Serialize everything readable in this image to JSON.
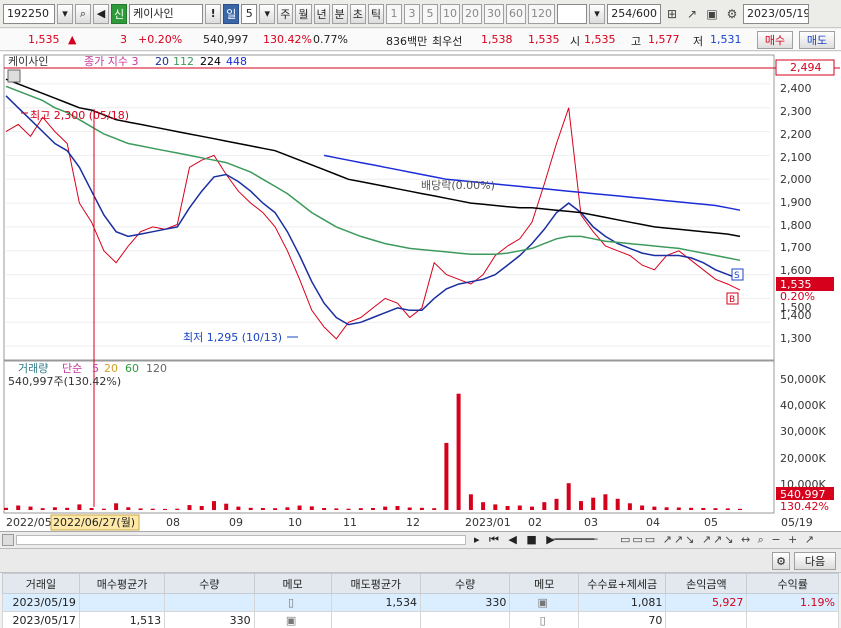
{
  "toolbar": {
    "code": "192250",
    "credit_badge": "신",
    "stock_name": "케이사인",
    "warn": "!",
    "period_active": "일",
    "period_count": "5",
    "periods": [
      "주",
      "월",
      "년",
      "분",
      "초",
      "틱"
    ],
    "intervals": [
      "1",
      "3",
      "5",
      "10",
      "20",
      "30",
      "60",
      "120"
    ],
    "page_counter": "254/600",
    "date": "2023/05/19"
  },
  "quote": {
    "price": "1,535",
    "change_arrow": "▲",
    "change": "3",
    "change_pct": "+0.20%",
    "volume": "540,997",
    "volume_ratio": "130.42%",
    "turnover": "0.77%",
    "amount": "836백만",
    "best_ask_label": "최우선",
    "best_ask": "1,538",
    "best_bid": "1,535",
    "open_label": "시",
    "open": "1,535",
    "high_label": "고",
    "high": "1,577",
    "low_label": "저",
    "low": "1,531",
    "buy_label": "매수",
    "sell_label": "매도"
  },
  "chart": {
    "title": "케이사인",
    "legend_label": "종가 지수 3",
    "legend_ma": [
      "20",
      "112",
      "224",
      "448"
    ],
    "legend_colors": [
      "#1a2ea0",
      "#3d9a5d",
      "#000000",
      "#1b2cd8"
    ],
    "high_annotation": "최고 2,300 (05/18)",
    "low_annotation": "최저 1,295 (10/13)",
    "dividend_annotation": "배당락(0.00%)",
    "top_price_tag": "2,494",
    "price_tag": "1,535",
    "pct_tag": "0.20%",
    "sell_marker": "S",
    "buy_marker": "B",
    "price_axis": [
      "2,400",
      "2,300",
      "2,200",
      "2,100",
      "2,000",
      "1,900",
      "1,800",
      "1,700",
      "1,600",
      "1,500",
      "1,400",
      "1,300"
    ],
    "volume_label": "거래량",
    "volume_ma_label": "단순",
    "volume_ma": [
      "5",
      "20",
      "60",
      "120"
    ],
    "volume_ma_colors": [
      "#c9369b",
      "#d2a020",
      "#2f9a3a",
      "#666666"
    ],
    "volume_value": "540,997주(130.42%)",
    "volume_axis": [
      "50,000K",
      "40,000K",
      "30,000K",
      "20,000K",
      "10,000K"
    ],
    "volume_tag": "540,997",
    "volume_pct_tag": "130.42%",
    "date_axis": [
      "2022/05",
      "08",
      "09",
      "10",
      "11",
      "12",
      "2023/01",
      "02",
      "03",
      "04",
      "05",
      "05/19"
    ],
    "crosshair_date": "2022/06/27(월)"
  },
  "grid_toolbar": {
    "next_label": "다음"
  },
  "trades": {
    "columns": [
      "거래일",
      "매수평균가",
      "수량",
      "메모",
      "매도평균가",
      "수량",
      "메모",
      "수수료+제세금",
      "손익금액",
      "수익률"
    ],
    "rows": [
      {
        "date": "2023/05/19",
        "buy_avg": "",
        "buy_qty": "",
        "sell_avg": "1,534",
        "sell_qty": "330",
        "fee": "1,081",
        "pnl": "5,927",
        "rate": "1.19%"
      },
      {
        "date": "2023/05/17",
        "buy_avg": "1,513",
        "buy_qty": "330",
        "sell_avg": "",
        "sell_qty": "",
        "fee": "70",
        "pnl": "",
        "rate": ""
      }
    ]
  },
  "chart_data": {
    "type": "line",
    "title": "케이사인",
    "x_range": [
      "2022/05",
      "2023/05/19"
    ],
    "ylim": [
      1250,
      2450
    ],
    "price_series": [
      {
        "name": "종가",
        "values": [
          2200,
          2230,
          2180,
          2260,
          2200,
          2150,
          1900,
          1820,
          1700,
          1650,
          1720,
          1780,
          1800,
          1790,
          1810,
          2050,
          2080,
          2100,
          2020,
          1950,
          1900,
          1860,
          1800,
          1700,
          1580,
          1450,
          1380,
          1330,
          1400,
          1420,
          1460,
          1500,
          1480,
          1420,
          1460,
          1650,
          1600,
          1580,
          1560,
          1600,
          1680,
          1720,
          1750,
          1820,
          1980,
          2150,
          2300,
          1850,
          1780,
          1720,
          1700,
          1680,
          1640,
          1620,
          1680,
          1700,
          1660,
          1620,
          1580,
          1560,
          1535
        ]
      },
      {
        "name": "20",
        "values": [
          2350,
          2300,
          2250,
          2200,
          2150,
          2120,
          2050,
          1950,
          1850,
          1780,
          1760,
          1770,
          1780,
          1790,
          1800,
          1880,
          1950,
          2010,
          2020,
          1990,
          1950,
          1900,
          1860,
          1780,
          1680,
          1570,
          1480,
          1420,
          1390,
          1400,
          1420,
          1440,
          1460,
          1450,
          1450,
          1500,
          1540,
          1560,
          1570,
          1580,
          1600,
          1640,
          1680,
          1730,
          1790,
          1860,
          1900,
          1860,
          1800,
          1760,
          1730,
          1710,
          1690,
          1680,
          1680,
          1680,
          1670,
          1650,
          1620,
          1600,
          1580
        ]
      },
      {
        "name": "112",
        "values": [
          2390,
          2370,
          2350,
          2330,
          2300,
          2280,
          2250,
          2220,
          2190,
          2170,
          2150,
          2140,
          2130,
          2120,
          2110,
          2100,
          2090,
          2080,
          2070,
          2050,
          2030,
          2000,
          1970,
          1940,
          1900,
          1860,
          1830,
          1800,
          1780,
          1760,
          1745,
          1730,
          1720,
          1710,
          1705,
          1700,
          1695,
          1690,
          1685,
          1685,
          1685,
          1690,
          1700,
          1710,
          1730,
          1750,
          1760,
          1760,
          1750,
          1740,
          1735,
          1730,
          1725,
          1720,
          1715,
          1710,
          1700,
          1690,
          1680,
          1670,
          1660
        ]
      },
      {
        "name": "224",
        "values": [
          2420,
          2400,
          2380,
          2360,
          2340,
          2320,
          2300,
          2290,
          2270,
          2250,
          2240,
          2230,
          2220,
          2210,
          2200,
          2190,
          2180,
          2170,
          2160,
          2150,
          2140,
          2130,
          2120,
          2100,
          2080,
          2060,
          2040,
          2020,
          2000,
          1990,
          1980,
          1970,
          1960,
          1950,
          1940,
          1930,
          1920,
          1910,
          1900,
          1895,
          1890,
          1885,
          1880,
          1880,
          1875,
          1870,
          1865,
          1860,
          1850,
          1840,
          1830,
          1820,
          1810,
          1800,
          1795,
          1790,
          1785,
          1780,
          1775,
          1770,
          1760
        ]
      },
      {
        "name": "448",
        "values": [
          null,
          null,
          null,
          null,
          null,
          null,
          null,
          null,
          null,
          null,
          null,
          null,
          null,
          null,
          null,
          null,
          null,
          null,
          null,
          null,
          null,
          null,
          null,
          null,
          null,
          null,
          2100,
          2090,
          2080,
          2070,
          2060,
          2050,
          2040,
          2030,
          2020,
          2010,
          2000,
          1995,
          1990,
          1985,
          1980,
          1975,
          1970,
          1965,
          1960,
          1955,
          1950,
          1945,
          1940,
          1935,
          1930,
          1925,
          1920,
          1915,
          1910,
          1905,
          1900,
          1895,
          1890,
          1880,
          1870
        ]
      }
    ],
    "volume": {
      "ylim": [
        0,
        55000
      ],
      "values": [
        1000,
        2000,
        1500,
        800,
        1200,
        1000,
        2500,
        900,
        600,
        3000,
        1200,
        700,
        600,
        500,
        600,
        2200,
        1800,
        4000,
        2800,
        1500,
        1000,
        900,
        800,
        1200,
        2000,
        1600,
        900,
        700,
        600,
        800,
        900,
        1500,
        1800,
        1100,
        1000,
        800,
        30000,
        52000,
        7000,
        3500,
        2500,
        1800,
        2000,
        1500,
        3500,
        5000,
        12000,
        4000,
        5500,
        7000,
        5000,
        3000,
        2000,
        1500,
        1200,
        1100,
        1000,
        900,
        800,
        700,
        541
      ]
    }
  }
}
